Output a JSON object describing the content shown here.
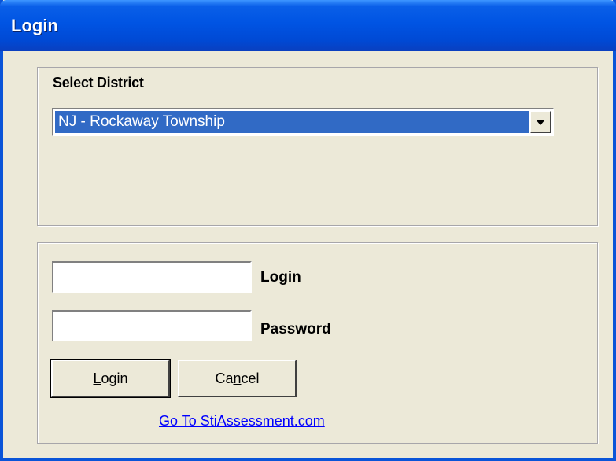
{
  "window": {
    "title": "Login"
  },
  "district": {
    "group_label": "Select District",
    "selected": "NJ - Rockaway Township"
  },
  "credentials": {
    "login_label": "Login",
    "password_label": "Password",
    "login_value": "",
    "password_value": ""
  },
  "buttons": {
    "login": {
      "pre": "",
      "accel": "L",
      "post": "ogin"
    },
    "cancel": {
      "pre": "Ca",
      "accel": "n",
      "post": "cel"
    }
  },
  "link": {
    "text": "Go To StiAssessment.com"
  },
  "colors": {
    "titlebar": "#0054e3",
    "selection": "#316ac5",
    "face": "#ece9d8",
    "link": "#0000ff"
  }
}
